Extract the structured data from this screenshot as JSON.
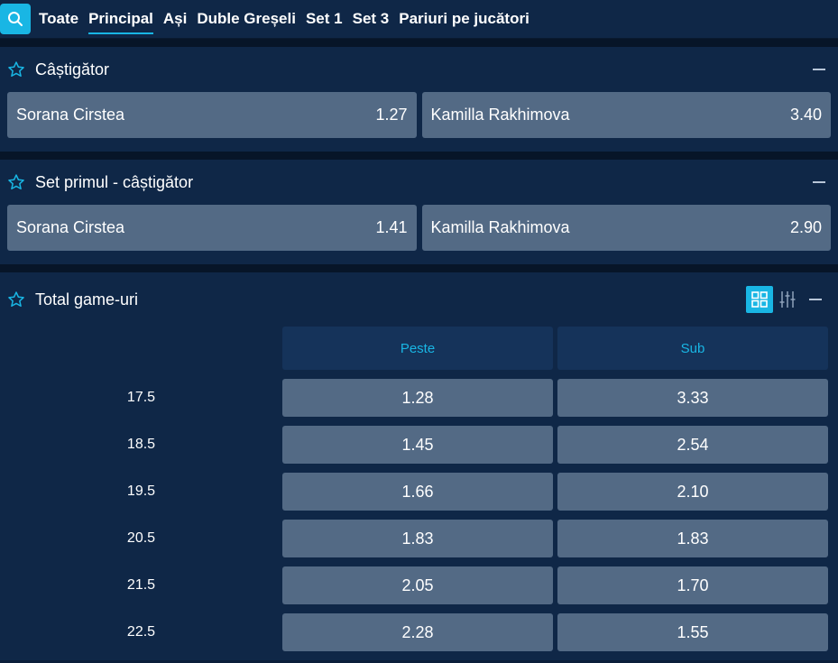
{
  "tabs": [
    "Toate",
    "Principal",
    "Ași",
    "Duble Greșeli",
    "Set 1",
    "Set 3",
    "Pariuri pe jucători"
  ],
  "active_tab": "Principal",
  "markets": [
    {
      "title": "Câștigător",
      "options": [
        {
          "name": "Sorana Cirstea",
          "odd": "1.27"
        },
        {
          "name": "Kamilla Rakhimova",
          "odd": "3.40"
        }
      ]
    },
    {
      "title": "Set primul - câștigător",
      "options": [
        {
          "name": "Sorana Cirstea",
          "odd": "1.41"
        },
        {
          "name": "Kamilla Rakhimova",
          "odd": "2.90"
        }
      ]
    }
  ],
  "total_games": {
    "title": "Total game-uri",
    "col_over": "Peste",
    "col_under": "Sub",
    "rows": [
      {
        "line": "17.5",
        "over": "1.28",
        "under": "3.33"
      },
      {
        "line": "18.5",
        "over": "1.45",
        "under": "2.54"
      },
      {
        "line": "19.5",
        "over": "1.66",
        "under": "2.10"
      },
      {
        "line": "20.5",
        "over": "1.83",
        "under": "1.83"
      },
      {
        "line": "21.5",
        "over": "2.05",
        "under": "1.70"
      },
      {
        "line": "22.5",
        "over": "2.28",
        "under": "1.55"
      }
    ]
  },
  "icons": {
    "search": "search-icon",
    "star": "star-icon",
    "collapse": "minus-icon",
    "grid": "grid-view-icon",
    "sliders": "sliders-icon"
  },
  "colors": {
    "accent": "#19b6e4",
    "panel": "#0f2747",
    "odd_button": "#536a85"
  }
}
